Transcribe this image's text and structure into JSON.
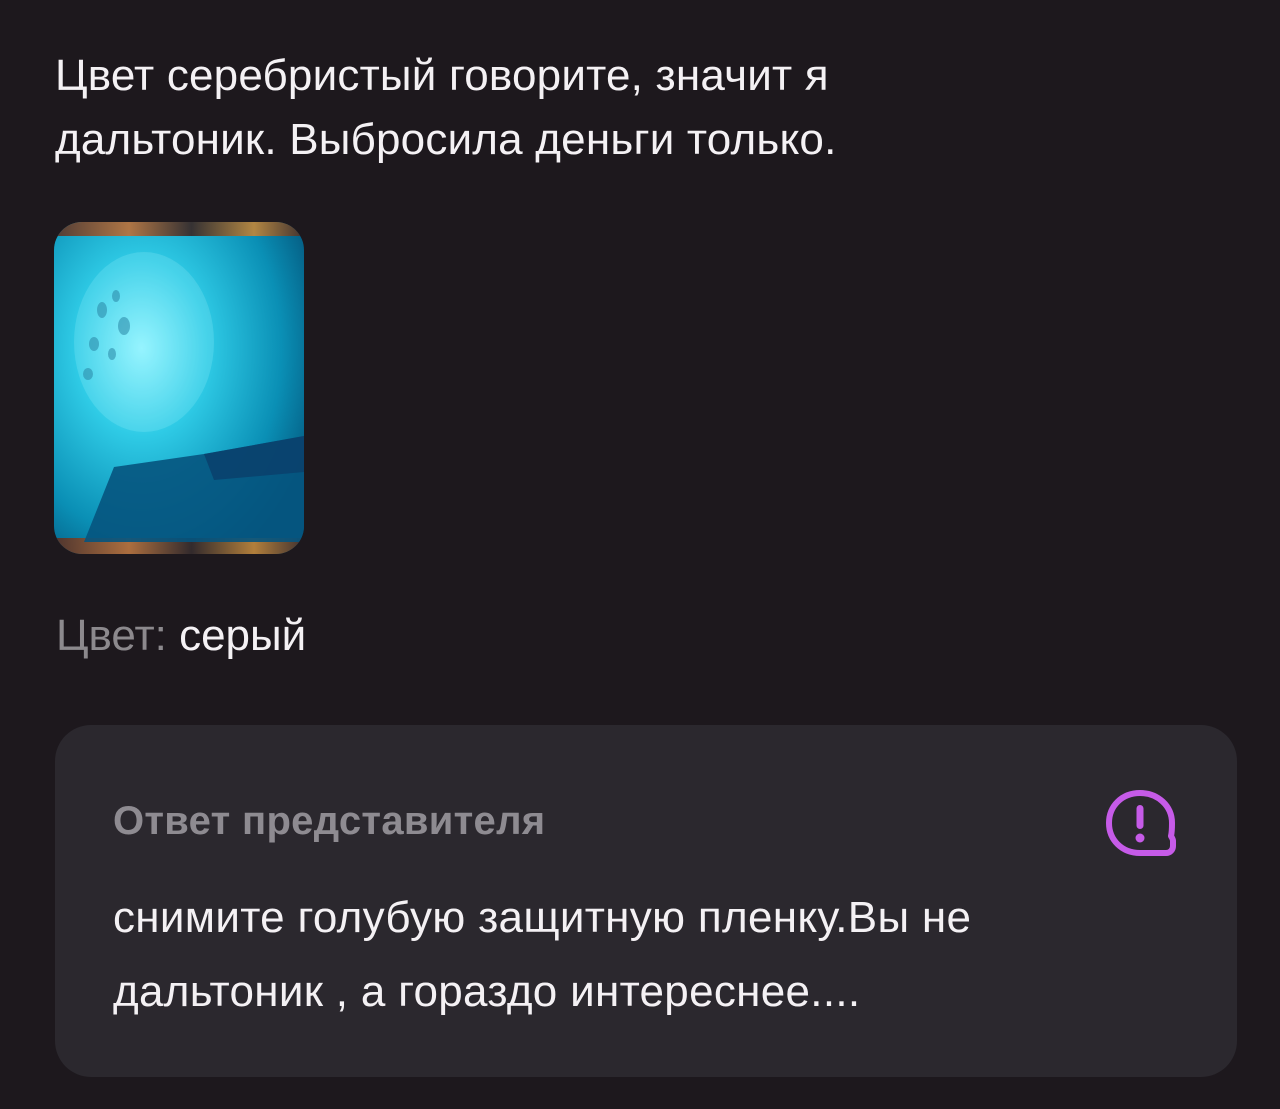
{
  "review": {
    "text": "Цвет серебристый говорите, значит я дальтоник. Выбросила деньги только."
  },
  "photo": {
    "icon": "product-photo-thumbnail"
  },
  "product_color": {
    "label": "Цвет:",
    "value": "серый"
  },
  "seller_answer": {
    "title": "Ответ представителя",
    "icon": "speech-bubble-exclamation-icon",
    "icon_color": "#c65be8",
    "text": "снимите голубую защитную пленку.Вы не дальтоник , а гораздо интереснее...."
  },
  "colors": {
    "background": "#1d181d",
    "card": "#2b282e",
    "accent": "#c65be8"
  }
}
